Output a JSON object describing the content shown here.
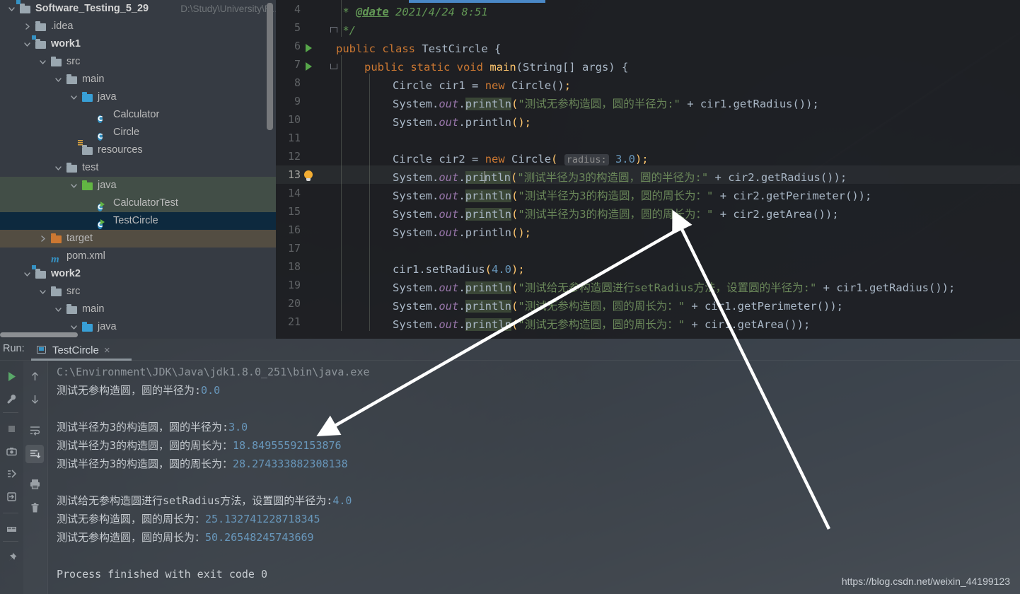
{
  "project": {
    "scrollbar": "vertical-scrollbar",
    "rows": [
      {
        "indent": 0,
        "twisty": "down",
        "icon": "module-folder",
        "label": "Software_Testing_5_29",
        "bold": true,
        "path": "D:\\Study\\University\\R…",
        "state": "normal"
      },
      {
        "indent": 1,
        "twisty": "right",
        "icon": "folder",
        "label": ".idea",
        "bold": false,
        "path": "",
        "state": "normal"
      },
      {
        "indent": 1,
        "twisty": "down",
        "icon": "module-folder",
        "label": "work1",
        "bold": true,
        "path": "",
        "state": "normal"
      },
      {
        "indent": 2,
        "twisty": "down",
        "icon": "folder",
        "label": "src",
        "bold": false,
        "path": "",
        "state": "normal"
      },
      {
        "indent": 3,
        "twisty": "down",
        "icon": "folder",
        "label": "main",
        "bold": false,
        "path": "",
        "state": "normal"
      },
      {
        "indent": 4,
        "twisty": "down",
        "icon": "source-folder",
        "label": "java",
        "bold": false,
        "path": "",
        "state": "normal"
      },
      {
        "indent": 5,
        "twisty": "none",
        "icon": "java-class",
        "label": "Calculator",
        "bold": false,
        "path": "",
        "state": "normal"
      },
      {
        "indent": 5,
        "twisty": "none",
        "icon": "java-class",
        "label": "Circle",
        "bold": false,
        "path": "",
        "state": "normal"
      },
      {
        "indent": 4,
        "twisty": "none",
        "icon": "resources-folder",
        "label": "resources",
        "bold": false,
        "path": "",
        "state": "normal"
      },
      {
        "indent": 3,
        "twisty": "down",
        "icon": "folder",
        "label": "test",
        "bold": false,
        "path": "",
        "state": "normal"
      },
      {
        "indent": 4,
        "twisty": "down",
        "icon": "test-source-folder",
        "label": "java",
        "bold": false,
        "path": "",
        "state": "green"
      },
      {
        "indent": 5,
        "twisty": "none",
        "icon": "java-test-class",
        "label": "CalculatorTest",
        "bold": false,
        "path": "",
        "state": "green"
      },
      {
        "indent": 5,
        "twisty": "none",
        "icon": "java-test-class",
        "label": "TestCircle",
        "bold": false,
        "path": "",
        "state": "selected"
      },
      {
        "indent": 2,
        "twisty": "right",
        "icon": "excluded-folder",
        "label": "target",
        "bold": false,
        "path": "",
        "state": "brown"
      },
      {
        "indent": 2,
        "twisty": "none",
        "icon": "maven-file",
        "label": "pom.xml",
        "bold": false,
        "path": "",
        "state": "normal"
      },
      {
        "indent": 1,
        "twisty": "down",
        "icon": "module-folder",
        "label": "work2",
        "bold": true,
        "path": "",
        "state": "normal"
      },
      {
        "indent": 2,
        "twisty": "down",
        "icon": "folder",
        "label": "src",
        "bold": false,
        "path": "",
        "state": "normal"
      },
      {
        "indent": 3,
        "twisty": "down",
        "icon": "folder",
        "label": "main",
        "bold": false,
        "path": "",
        "state": "normal"
      },
      {
        "indent": 4,
        "twisty": "down",
        "icon": "source-folder",
        "label": "java",
        "bold": false,
        "path": "",
        "state": "normal"
      }
    ]
  },
  "editor": {
    "current_line": 13,
    "first_line_number": 4,
    "lines": [
      {
        "n": 4,
        "gutter": "",
        "fold": "",
        "indent_guides": [
          0
        ]
      },
      {
        "n": 5,
        "gutter": "",
        "fold": "up",
        "indent_guides": [
          0
        ]
      },
      {
        "n": 6,
        "gutter": "run",
        "fold": "",
        "indent_guides": []
      },
      {
        "n": 7,
        "gutter": "run",
        "fold": "down",
        "indent_guides": [
          0
        ]
      },
      {
        "n": 8,
        "gutter": "",
        "fold": "",
        "indent_guides": [
          0,
          1
        ]
      },
      {
        "n": 9,
        "gutter": "",
        "fold": "",
        "indent_guides": [
          0,
          1
        ]
      },
      {
        "n": 10,
        "gutter": "",
        "fold": "",
        "indent_guides": [
          0,
          1
        ]
      },
      {
        "n": 11,
        "gutter": "",
        "fold": "",
        "indent_guides": [
          0,
          1
        ]
      },
      {
        "n": 12,
        "gutter": "",
        "fold": "",
        "indent_guides": [
          0,
          1
        ]
      },
      {
        "n": 13,
        "gutter": "bulb",
        "fold": "",
        "indent_guides": [
          0,
          1
        ]
      },
      {
        "n": 14,
        "gutter": "",
        "fold": "",
        "indent_guides": [
          0,
          1
        ]
      },
      {
        "n": 15,
        "gutter": "",
        "fold": "",
        "indent_guides": [
          0,
          1
        ]
      },
      {
        "n": 16,
        "gutter": "",
        "fold": "",
        "indent_guides": [
          0,
          1
        ]
      },
      {
        "n": 17,
        "gutter": "",
        "fold": "",
        "indent_guides": [
          0,
          1
        ]
      },
      {
        "n": 18,
        "gutter": "",
        "fold": "",
        "indent_guides": [
          0,
          1
        ]
      },
      {
        "n": 19,
        "gutter": "",
        "fold": "",
        "indent_guides": [
          0,
          1
        ]
      },
      {
        "n": 20,
        "gutter": "",
        "fold": "",
        "indent_guides": [
          0,
          1
        ]
      },
      {
        "n": 21,
        "gutter": "",
        "fold": "",
        "indent_guides": [
          0,
          1
        ]
      }
    ],
    "code": {
      "l4": " * @date 2021/4/24 8:51",
      "l4_tag": "@date",
      "l4_rest": " 2021/4/24 8:51",
      "l5": " */",
      "l6_kw1": "public",
      "l6_kw2": "class",
      "l6_name": "TestCircle",
      "l6_brace": "{",
      "l7_kw": "public static void",
      "l7_name": "main",
      "l7_args": "(String[] args) {",
      "l8": "Circle cir1 = new Circle();",
      "l9_str": "\"测试无参构造圆，圆的半径为:\"",
      "l9_tail": " + cir1.getRadius());",
      "l10": "System.out.println();",
      "l12_hint": "radius:",
      "l12_num": "3.0",
      "l13_str": "\"测试半径为3的构造圆，圆的半径为:\"",
      "l13_tail": " + cir2.getRadius());",
      "l14_str": "\"测试半径为3的构造圆，圆的周长为：\"",
      "l14_tail": " + cir2.getPerimeter());",
      "l15_str": "\"测试半径为3的构造圆，圆的周长为：\"",
      "l15_tail": " + cir2.getArea());",
      "l16": "System.out.println();",
      "l18": "cir1.setRadius(4.0);",
      "l19_str": "\"测试给无参构造圆进行setRadius方法，设置圆的半径为:\"",
      "l19_tail": " + cir1.getRadius());",
      "l20_str": "\"测试无参构造圆，圆的周长为：\"",
      "l20_tail": " + cir1.getPerimeter());",
      "l21_str": "\"测试无参构造圆，圆的周长为：\"",
      "l21_tail": " + cir1.getArea());"
    }
  },
  "run_panel": {
    "label": "Run:",
    "tab_name": "TestCircle",
    "tab_close": "×",
    "toolbar_left": [
      {
        "name": "rerun-button",
        "glyph": "play"
      },
      {
        "name": "settings-button",
        "glyph": "wrench"
      },
      {
        "name": "stop-button",
        "glyph": "stop"
      },
      {
        "name": "screenshot-button",
        "glyph": "camera"
      },
      {
        "name": "thread-dump-button",
        "glyph": "threads"
      },
      {
        "name": "export-button",
        "glyph": "export"
      },
      {
        "name": "layout-button",
        "glyph": "layout"
      },
      {
        "name": "pin-button",
        "glyph": "pin"
      }
    ],
    "toolbar_right": [
      {
        "name": "up-button",
        "glyph": "arrow-up"
      },
      {
        "name": "down-button",
        "glyph": "arrow-down"
      },
      {
        "name": "soft-wrap-button",
        "glyph": "wrap"
      },
      {
        "name": "scroll-to-end-button",
        "glyph": "scroll-end",
        "active": true
      },
      {
        "name": "print-button",
        "glyph": "printer"
      },
      {
        "name": "clear-all-button",
        "glyph": "trash"
      }
    ],
    "console_lines": [
      {
        "text": "C:\\Environment\\JDK\\Java\\jdk1.8.0_251\\bin\\java.exe",
        "style": "dim"
      },
      {
        "text": "测试无参构造圆，圆的半径为:0.0",
        "style": "normal"
      },
      {
        "text": "",
        "style": "normal"
      },
      {
        "text": "测试半径为3的构造圆，圆的半径为:3.0",
        "style": "normal"
      },
      {
        "text": "测试半径为3的构造圆，圆的周长为：18.84955592153876",
        "style": "normal"
      },
      {
        "text": "测试半径为3的构造圆，圆的周长为：28.274333882308138",
        "style": "normal"
      },
      {
        "text": "",
        "style": "normal"
      },
      {
        "text": "测试给无参构造圆进行setRadius方法，设置圆的半径为:4.0",
        "style": "normal"
      },
      {
        "text": "测试无参构造圆，圆的周长为：25.132741228718345",
        "style": "normal"
      },
      {
        "text": "测试无参构造圆，圆的周长为：50.26548245743669",
        "style": "normal"
      },
      {
        "text": "",
        "style": "normal"
      },
      {
        "text": "Process finished with exit code 0",
        "style": "normal"
      }
    ]
  },
  "watermark": "https://blog.csdn.net/weixin_44199123",
  "colors": {
    "accent_blue": "#3592c4",
    "keyword_orange": "#cc7832",
    "string_green": "#6a8759",
    "number_blue": "#6897bb",
    "method_yellow": "#ffc66d",
    "comment_green": "#629755",
    "field_purple": "#9876aa",
    "selection_blue": "#0d293e",
    "test_folder_green": "#62b543"
  }
}
